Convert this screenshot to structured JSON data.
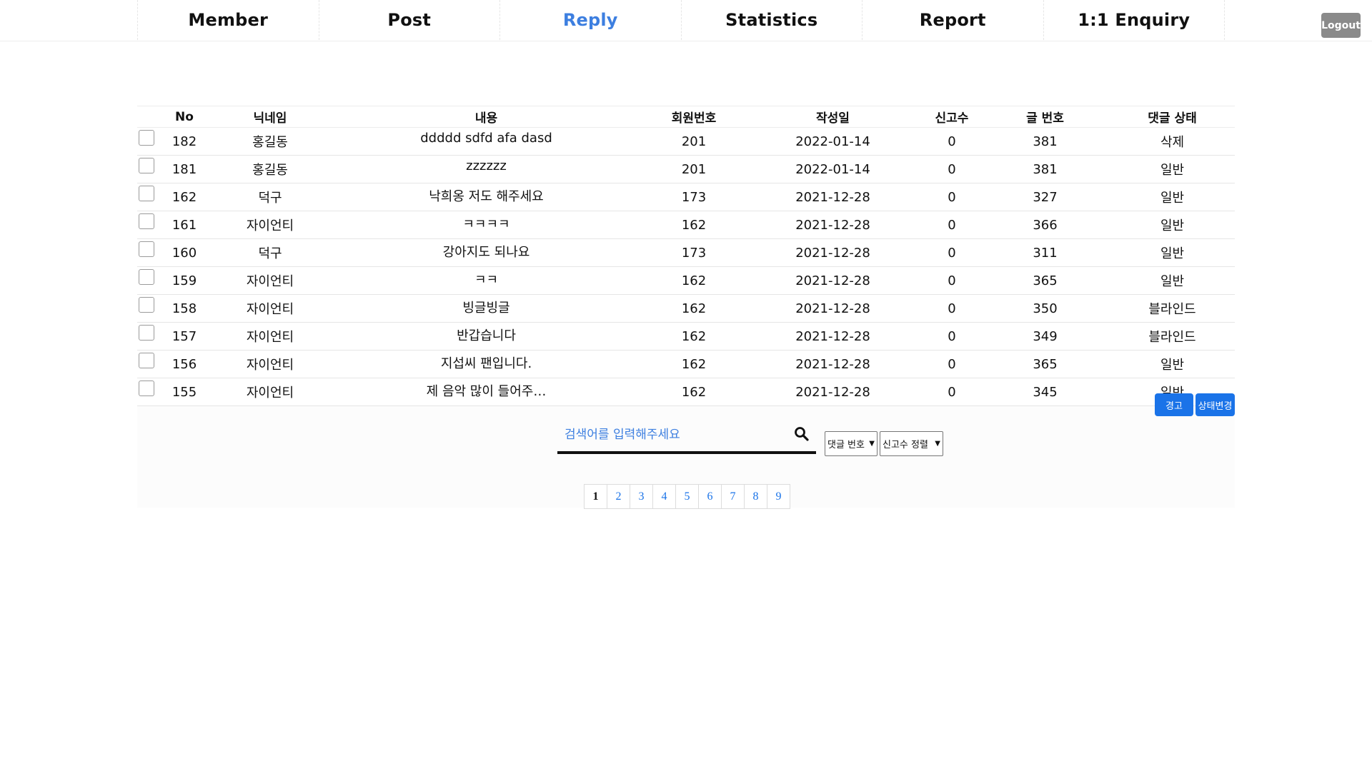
{
  "nav": {
    "items": [
      {
        "label": "Member"
      },
      {
        "label": "Post"
      },
      {
        "label": "Reply"
      },
      {
        "label": "Statistics"
      },
      {
        "label": "Report"
      },
      {
        "label": "1:1 Enquiry"
      }
    ],
    "active": "Reply",
    "logout_label": "Logout"
  },
  "table": {
    "headers": [
      "No",
      "닉네임",
      "내용",
      "회원번호",
      "작성일",
      "신고수",
      "글 번호",
      "댓글 상태"
    ],
    "rows": [
      {
        "no": "182",
        "nickname": "홍길동",
        "content": "ddddd sdfd afa dasd",
        "member_no": "201",
        "date": "2022-01-14",
        "reports": "0",
        "post_no": "381",
        "status": "삭제"
      },
      {
        "no": "181",
        "nickname": "홍길동",
        "content": "zzzzzz",
        "member_no": "201",
        "date": "2022-01-14",
        "reports": "0",
        "post_no": "381",
        "status": "일반"
      },
      {
        "no": "162",
        "nickname": "덕구",
        "content": "낙희옹 저도 해주세요",
        "member_no": "173",
        "date": "2021-12-28",
        "reports": "0",
        "post_no": "327",
        "status": "일반"
      },
      {
        "no": "161",
        "nickname": "자이언티",
        "content": "ㅋㅋㅋㅋ",
        "member_no": "162",
        "date": "2021-12-28",
        "reports": "0",
        "post_no": "366",
        "status": "일반"
      },
      {
        "no": "160",
        "nickname": "덕구",
        "content": "강아지도 되나요",
        "member_no": "173",
        "date": "2021-12-28",
        "reports": "0",
        "post_no": "311",
        "status": "일반"
      },
      {
        "no": "159",
        "nickname": "자이언티",
        "content": "ㅋㅋ",
        "member_no": "162",
        "date": "2021-12-28",
        "reports": "0",
        "post_no": "365",
        "status": "일반"
      },
      {
        "no": "158",
        "nickname": "자이언티",
        "content": "빙글빙글",
        "member_no": "162",
        "date": "2021-12-28",
        "reports": "0",
        "post_no": "350",
        "status": "블라인드"
      },
      {
        "no": "157",
        "nickname": "자이언티",
        "content": "반갑습니다",
        "member_no": "162",
        "date": "2021-12-28",
        "reports": "0",
        "post_no": "349",
        "status": "블라인드"
      },
      {
        "no": "156",
        "nickname": "자이언티",
        "content": "지섭씨 팬입니다.",
        "member_no": "162",
        "date": "2021-12-28",
        "reports": "0",
        "post_no": "365",
        "status": "일반"
      },
      {
        "no": "155",
        "nickname": "자이언티",
        "content": "제 음악 많이 들어주…",
        "member_no": "162",
        "date": "2021-12-28",
        "reports": "0",
        "post_no": "345",
        "status": "일반"
      }
    ]
  },
  "actions": {
    "warn_label": "경고",
    "change_state_label": "상태변경"
  },
  "search": {
    "placeholder": "검색어를 입력해주세요",
    "icon": "search-icon",
    "filter_selected": "댓글 번호",
    "sort_selected": "신고수 정렬"
  },
  "pagination": {
    "pages": [
      "1",
      "2",
      "3",
      "4",
      "5",
      "6",
      "7",
      "8",
      "9"
    ],
    "current": "1"
  },
  "colors": {
    "accent": "#3d7fe0",
    "button_blue": "#1a73e8",
    "logout_gray": "#8a8a8a"
  }
}
